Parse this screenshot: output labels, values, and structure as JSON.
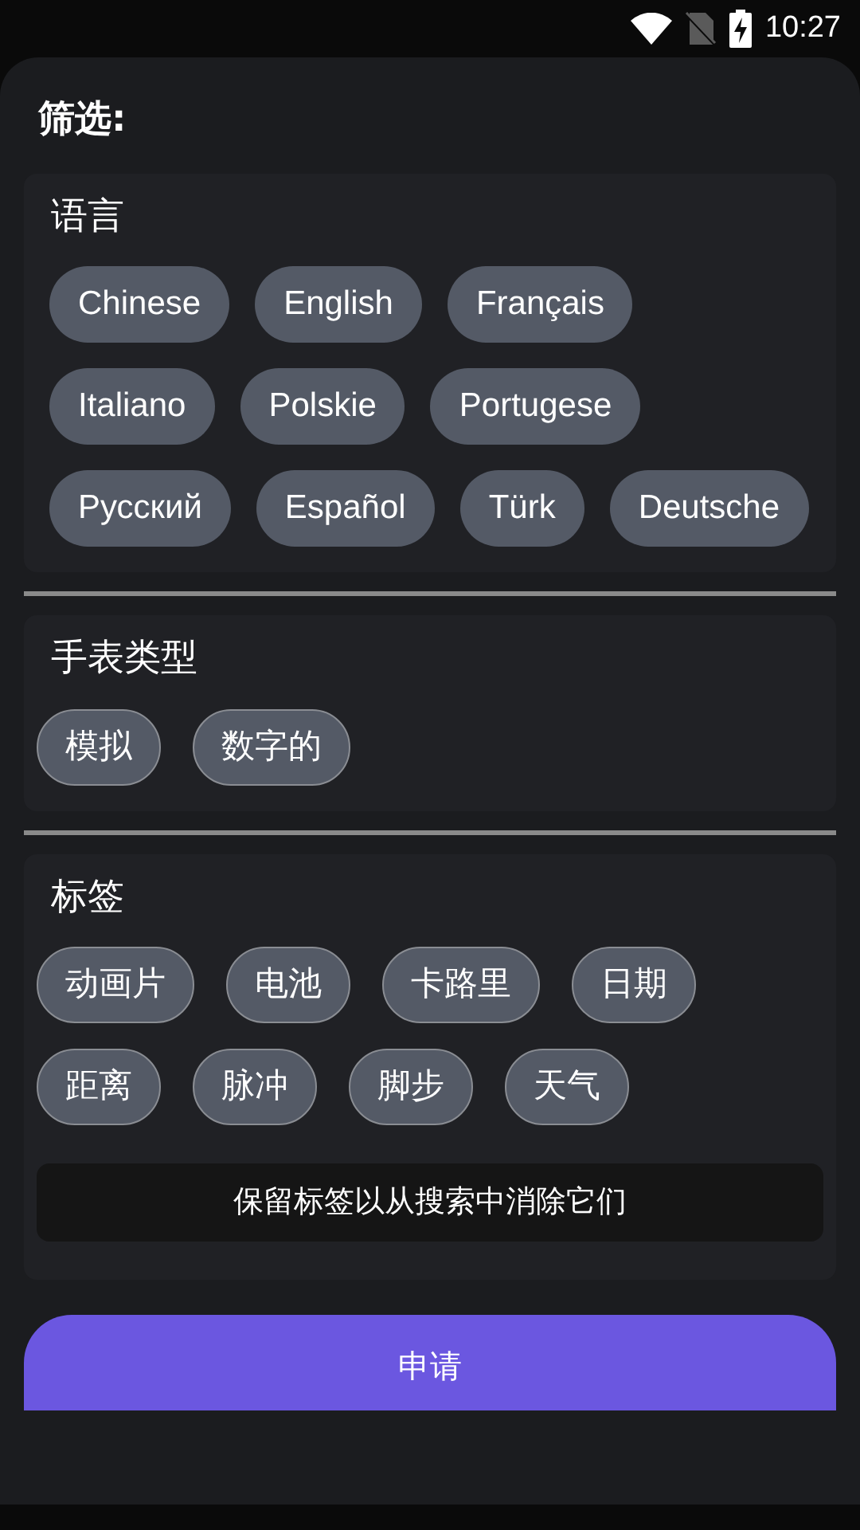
{
  "status_bar": {
    "time": "10:27"
  },
  "title": "筛选:",
  "sections": [
    {
      "heading": "语言",
      "kind": "filled",
      "chips": [
        "Chinese",
        "English",
        "Français",
        "Italiano",
        "Polskie",
        "Portugese",
        "Русский",
        "Español",
        "Türk",
        "Deutsche"
      ]
    },
    {
      "heading": "手表类型",
      "kind": "outlined",
      "chips": [
        "模拟",
        "数字的"
      ]
    },
    {
      "heading": "标签",
      "kind": "outlined",
      "chips": [
        "动画片",
        "电池",
        "卡路里",
        "日期",
        "距离",
        "脉冲",
        "脚步",
        "天气"
      ],
      "hint": "保留标签以从搜索中消除它们"
    }
  ],
  "apply_button": "申请"
}
